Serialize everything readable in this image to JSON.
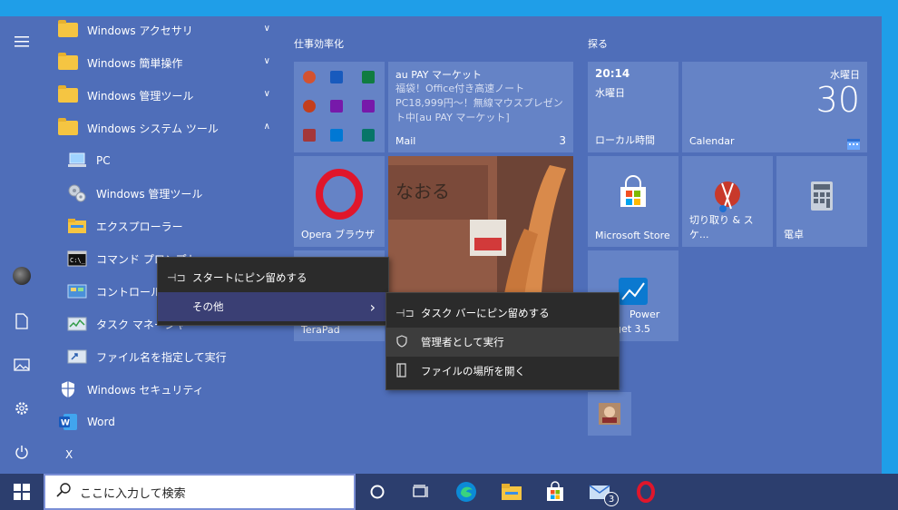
{
  "apps": [
    {
      "label": "Windows アクセサリ",
      "chevron": "∨"
    },
    {
      "label": "Windows 簡単操作",
      "chevron": "∨"
    },
    {
      "label": "Windows 管理ツール",
      "chevron": "∨"
    },
    {
      "label": "Windows システム ツール",
      "chevron": "∧"
    },
    {
      "label": "PC"
    },
    {
      "label": "Windows 管理ツール"
    },
    {
      "label": "エクスプローラー"
    },
    {
      "label": "コマンド プロンプト"
    },
    {
      "label": "コントロール パネル"
    },
    {
      "label": "タスク マネージャー"
    },
    {
      "label": "ファイル名を指定して実行"
    },
    {
      "label": "Windows セキュリティ"
    },
    {
      "label": "Word"
    },
    {
      "label": "X"
    }
  ],
  "groups": {
    "productivity": "仕事効率化",
    "explore": "探る"
  },
  "tiles": {
    "aupay_title": "au PAY マーケット",
    "aupay_body": "福袋！Office付き高速ノートPC18,999円〜！無線マウスプレゼント中[au PAY マーケット]",
    "mail_label": "Mail",
    "mail_count": "3",
    "opera_label": "Opera ブラウザ",
    "terapad_label": "TeraPad",
    "time": "20:14",
    "weekday_small": "水曜日",
    "localtime_label": "ローカル時間",
    "weekday": "水曜日",
    "day": "30",
    "calendar_label": "Calendar",
    "store_label": "Microsoft Store",
    "snip_label": "切り取り & スケ...",
    "calc_label": "電卓",
    "power_label": "Power",
    "power_sub": "get 3.5"
  },
  "context_menu": {
    "pin_start": "スタートにピン留めする",
    "more": "その他",
    "more_arrow": "›"
  },
  "submenu": {
    "pin_taskbar": "タスク バーにピン留めする",
    "run_admin": "管理者として実行",
    "open_location": "ファイルの場所を開く"
  },
  "taskbar": {
    "search_placeholder": "ここに入力して検索",
    "mail_badge": "3"
  },
  "colors": {
    "start_bg": "#4f6eb9",
    "tile_bg": "#6583c6",
    "menu_bg": "#2b2b2b",
    "menu_highlight": "#3d3d3d",
    "taskbar_bg": "#2c3e6e"
  }
}
